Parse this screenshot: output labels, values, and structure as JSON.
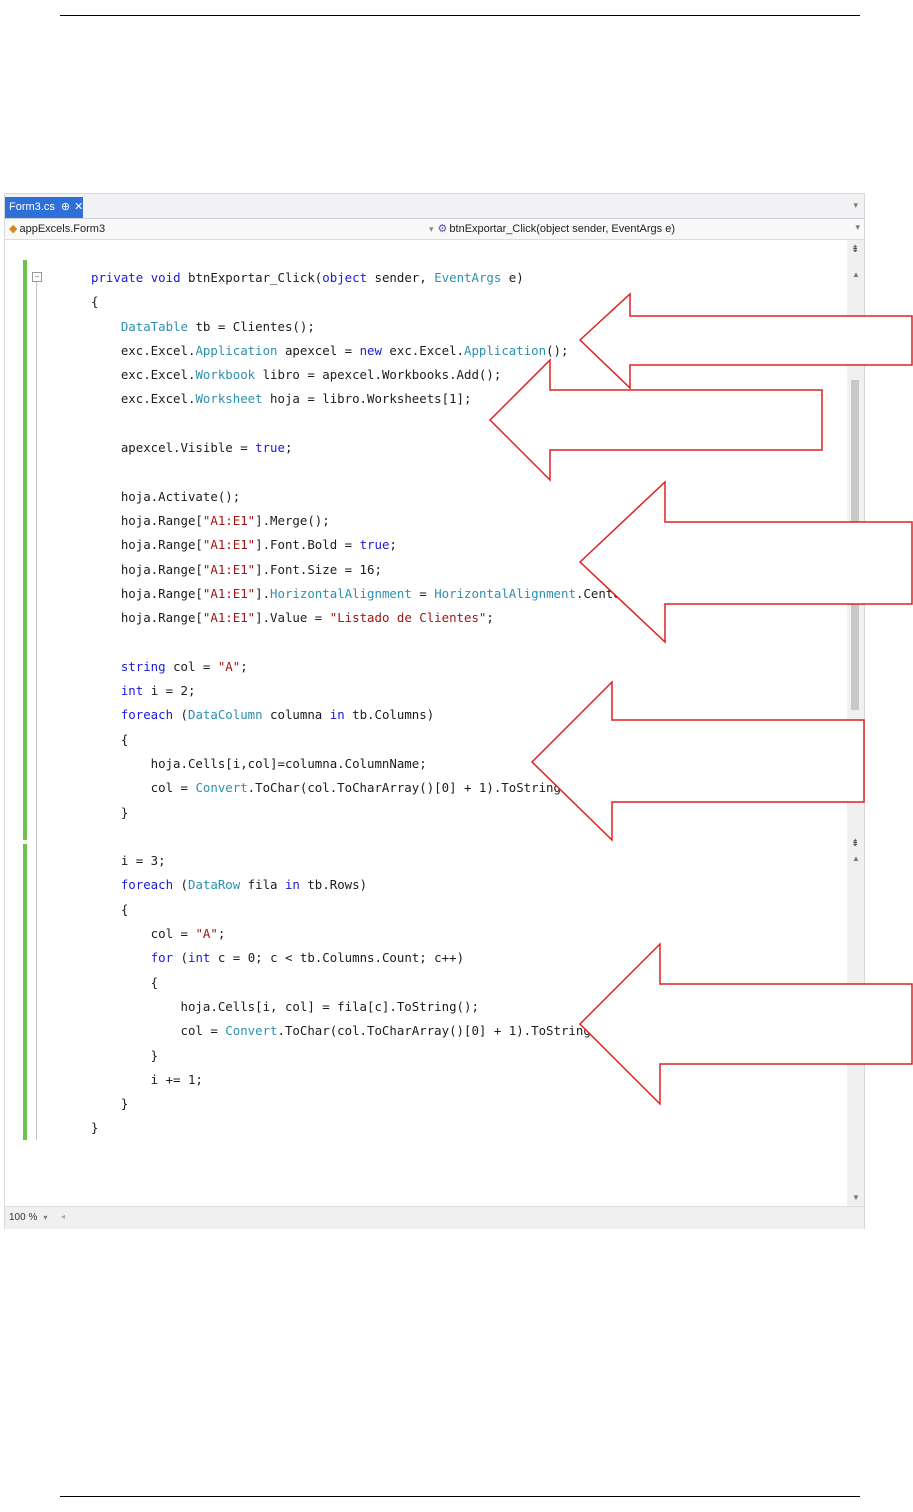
{
  "tab": {
    "label": "Form3.cs",
    "pin": "⊕",
    "close": "✕"
  },
  "nav": {
    "left_class": "appExcels.Form3",
    "right_member": "btnExportar_Click(object sender, EventArgs e)"
  },
  "status": {
    "zoom": "100 %"
  },
  "code_lines": [
    "private void btnExportar_Click(object sender, EventArgs e)",
    "{",
    "    DataTable tb = Clientes();",
    "    exc.Excel.Application apexcel = new exc.Excel.Application();",
    "    exc.Excel.Workbook libro = apexcel.Workbooks.Add();",
    "    exc.Excel.Worksheet hoja = libro.Worksheets[1];",
    "",
    "    apexcel.Visible = true;",
    "",
    "    hoja.Activate();",
    "    hoja.Range[\"A1:E1\"].Merge();",
    "    hoja.Range[\"A1:E1\"].Font.Bold = true;",
    "    hoja.Range[\"A1:E1\"].Font.Size = 16;",
    "    hoja.Range[\"A1:E1\"].HorizontalAlignment = HorizontalAlignment.Center;",
    "    hoja.Range[\"A1:E1\"].Value = \"Listado de Clientes\";",
    "",
    "    string col = \"A\";",
    "    int i = 2;",
    "    foreach (DataColumn columna in tb.Columns)",
    "    {",
    "        hoja.Cells[i,col]=columna.ColumnName;",
    "        col = Convert.ToChar(col.ToCharArray()[0] + 1).ToString();",
    "    }",
    "",
    "    i = 3;",
    "    foreach (DataRow fila in tb.Rows)",
    "    {",
    "        col = \"A\";",
    "        for (int c = 0; c < tb.Columns.Count; c++)",
    "        {",
    "            hoja.Cells[i, col] = fila[c].ToString();",
    "            col = Convert.ToChar(col.ToCharArray()[0] + 1).ToString();",
    "        }",
    "        i += 1;",
    "    }",
    "}"
  ],
  "colors": {
    "keyword": "#1a1ad8",
    "type": "#2b91af",
    "string": "#a31515",
    "arrow_stroke": "#e02020",
    "tab_active": "#2f6fd8"
  }
}
